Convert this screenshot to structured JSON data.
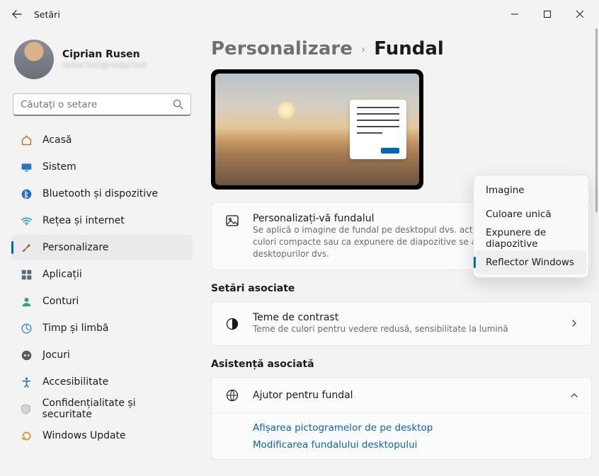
{
  "titlebar": {
    "app_title": "Setări"
  },
  "profile": {
    "name": "Ciprian Rusen",
    "subtitle": "redacted@redacted"
  },
  "search": {
    "placeholder": "Căutați o setare"
  },
  "nav": {
    "items": [
      {
        "key": "home",
        "label": "Acasă"
      },
      {
        "key": "system",
        "label": "Sistem"
      },
      {
        "key": "bluetooth",
        "label": "Bluetooth și dispozitive"
      },
      {
        "key": "network",
        "label": "Rețea și internet"
      },
      {
        "key": "personalize",
        "label": "Personalizare"
      },
      {
        "key": "apps",
        "label": "Aplicații"
      },
      {
        "key": "accounts",
        "label": "Conturi"
      },
      {
        "key": "time",
        "label": "Timp și limbă"
      },
      {
        "key": "gaming",
        "label": "Jocuri"
      },
      {
        "key": "accessibility",
        "label": "Accesibilitate"
      },
      {
        "key": "privacy",
        "label": "Confidențialitate și securitate"
      },
      {
        "key": "update",
        "label": "Windows Update"
      }
    ]
  },
  "breadcrumb": {
    "parent": "Personalizare",
    "current": "Fundal"
  },
  "personalize_card": {
    "title": "Personalizați-vă fundalul",
    "subtitle": "Se aplică o imagine de fundal pe desktopul dvs. actual. Fundalurile în culori compacte sau ca expunere de diapozitive se aplică tuturor desktopurilor dvs."
  },
  "dropdown": {
    "options": [
      {
        "label": "Imagine"
      },
      {
        "label": "Culoare unică"
      },
      {
        "label": "Expunere de diapozitive"
      },
      {
        "label": "Reflector Windows",
        "selected": true
      }
    ]
  },
  "related": {
    "header": "Setări asociate",
    "contrast": {
      "title": "Teme de contrast",
      "subtitle": "Teme de culori pentru vedere redusă, sensibilitate la lumină"
    }
  },
  "assist": {
    "header": "Asistență asociată",
    "help_title": "Ajutor pentru fundal",
    "links": [
      "Afișarea pictogramelor de pe desktop",
      "Modificarea fundalului desktopului"
    ]
  }
}
